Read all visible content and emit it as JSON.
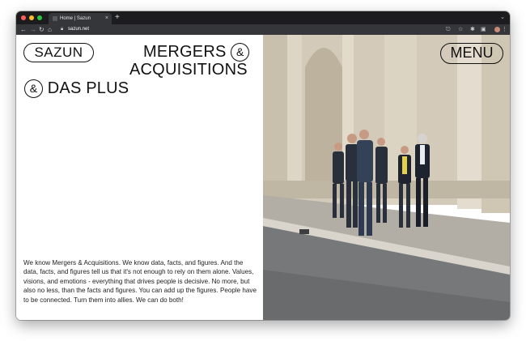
{
  "browser": {
    "tab_title": "Home | Sazun",
    "tab_close": "×",
    "new_tab": "+",
    "tab_menu": "⌄",
    "nav": {
      "back": "←",
      "forward": "→",
      "reload": "↻",
      "home": "⌂"
    },
    "url": "sazun.net",
    "toolbar_icons": {
      "share": "⎋",
      "bookmark": "☆",
      "extensions": "✱",
      "sidebar": "▣",
      "more": "⋮"
    }
  },
  "site": {
    "logo": "SAZUN",
    "headline": {
      "line1_word": "MERGERS",
      "amp": "&",
      "line2": "ACQUISITIONS",
      "line3_word": "DAS PLUS"
    },
    "menu_label": "MENU",
    "intro_text": "We know Mergers & Acquisitions. We know data, facts, and figures. And the data, facts, and figures tell us that it's not enough to rely on them alone. Values, visions, and emotions - everything that drives people is decisive. No more, but also no less, than the facts and figures. You can add up the figures. People have to be connected. Turn them into allies. We can do both!"
  },
  "colors": {
    "browser_frame": "#1c1c1e",
    "toolbar": "#35363a",
    "page_bg": "#ffffff",
    "ink": "#111111"
  }
}
